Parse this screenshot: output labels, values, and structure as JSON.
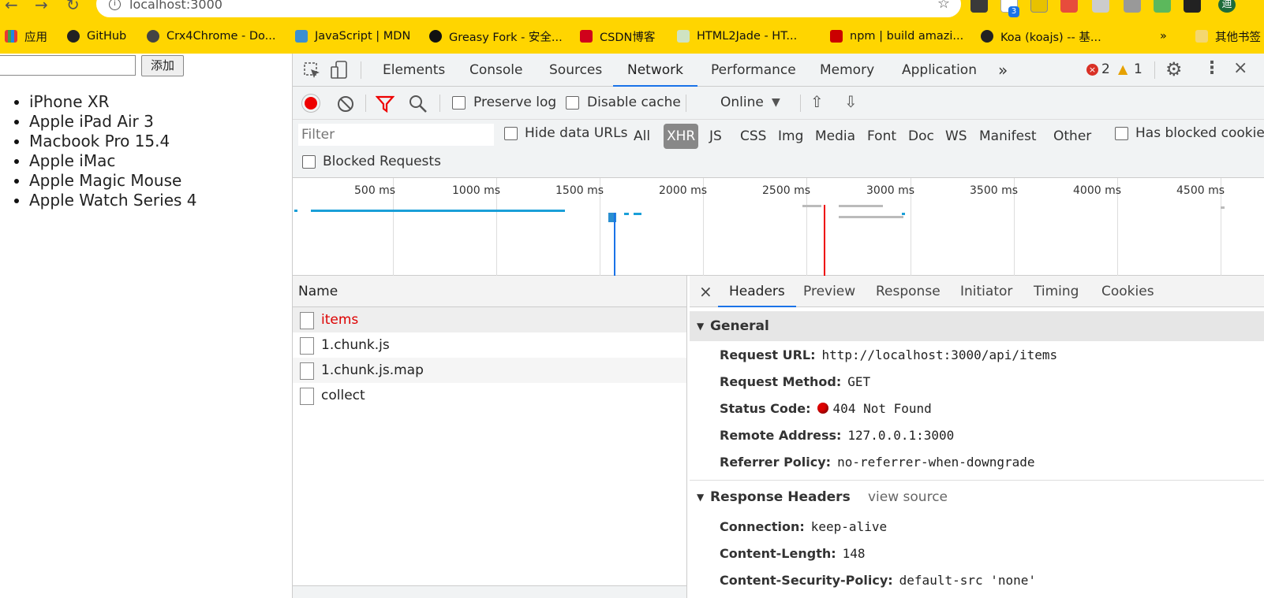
{
  "browser": {
    "url": "localhost:3000",
    "extension_badge": "3",
    "avatar_letter": "迪",
    "bookmarks": [
      {
        "label": "应用"
      },
      {
        "label": "GitHub"
      },
      {
        "label": "Crx4Chrome - Do..."
      },
      {
        "label": "JavaScript | MDN"
      },
      {
        "label": "Greasy Fork - 安全..."
      },
      {
        "label": "CSDN博客"
      },
      {
        "label": "HTML2Jade - HT..."
      },
      {
        "label": "npm | build amazi..."
      },
      {
        "label": "Koa (koajs) -- 基..."
      }
    ],
    "more_bookmarks": "»",
    "other_bookmarks": "其他书签"
  },
  "page": {
    "add_button": "添加",
    "input_value": "",
    "items": [
      "iPhone XR",
      "Apple iPad Air 3",
      "Macbook Pro 15.4",
      "Apple iMac",
      "Apple Magic Mouse",
      "Apple Watch Series 4"
    ]
  },
  "devtools": {
    "tabs": [
      "Elements",
      "Console",
      "Sources",
      "Network",
      "Performance",
      "Memory",
      "Application"
    ],
    "active_tab": "Network",
    "more_tabs": "»",
    "error_count": "2",
    "warning_count": "1",
    "toolbar": {
      "preserve_log": "Preserve log",
      "disable_cache": "Disable cache",
      "throttle": "Online"
    },
    "filter": {
      "placeholder": "Filter",
      "hide_data_urls": "Hide data URLs",
      "types": [
        "All",
        "XHR",
        "JS",
        "CSS",
        "Img",
        "Media",
        "Font",
        "Doc",
        "WS",
        "Manifest",
        "Other"
      ],
      "selected_type": "XHR",
      "has_blocked_cookies": "Has blocked cookies",
      "blocked_requests": "Blocked Requests"
    },
    "timeline_ticks": [
      "500 ms",
      "1000 ms",
      "1500 ms",
      "2000 ms",
      "2500 ms",
      "3000 ms",
      "3500 ms",
      "4000 ms",
      "4500 ms"
    ],
    "name_header": "Name",
    "requests": [
      {
        "name": "items",
        "status": "error"
      },
      {
        "name": "1.chunk.js",
        "status": "ok"
      },
      {
        "name": "1.chunk.js.map",
        "status": "ok"
      },
      {
        "name": "collect",
        "status": "ok"
      }
    ],
    "detail": {
      "close": "×",
      "tabs": [
        "Headers",
        "Preview",
        "Response",
        "Initiator",
        "Timing",
        "Cookies"
      ],
      "active_tab": "Headers",
      "general_title": "General",
      "general": [
        {
          "key": "Request URL:",
          "value": "http://localhost:3000/api/items"
        },
        {
          "key": "Request Method:",
          "value": "GET"
        },
        {
          "key": "Status Code:",
          "value": "404 Not Found"
        },
        {
          "key": "Remote Address:",
          "value": "127.0.0.1:3000"
        },
        {
          "key": "Referrer Policy:",
          "value": "no-referrer-when-downgrade"
        }
      ],
      "response_headers_title": "Response Headers",
      "view_source": "view source",
      "response_headers": [
        {
          "key": "Connection:",
          "value": "keep-alive"
        },
        {
          "key": "Content-Length:",
          "value": "148"
        },
        {
          "key": "Content-Security-Policy:",
          "value": "default-src 'none'"
        }
      ]
    },
    "colors": {
      "accent": "#1a73e8",
      "error": "#dd0000",
      "record": "#e00000"
    }
  }
}
